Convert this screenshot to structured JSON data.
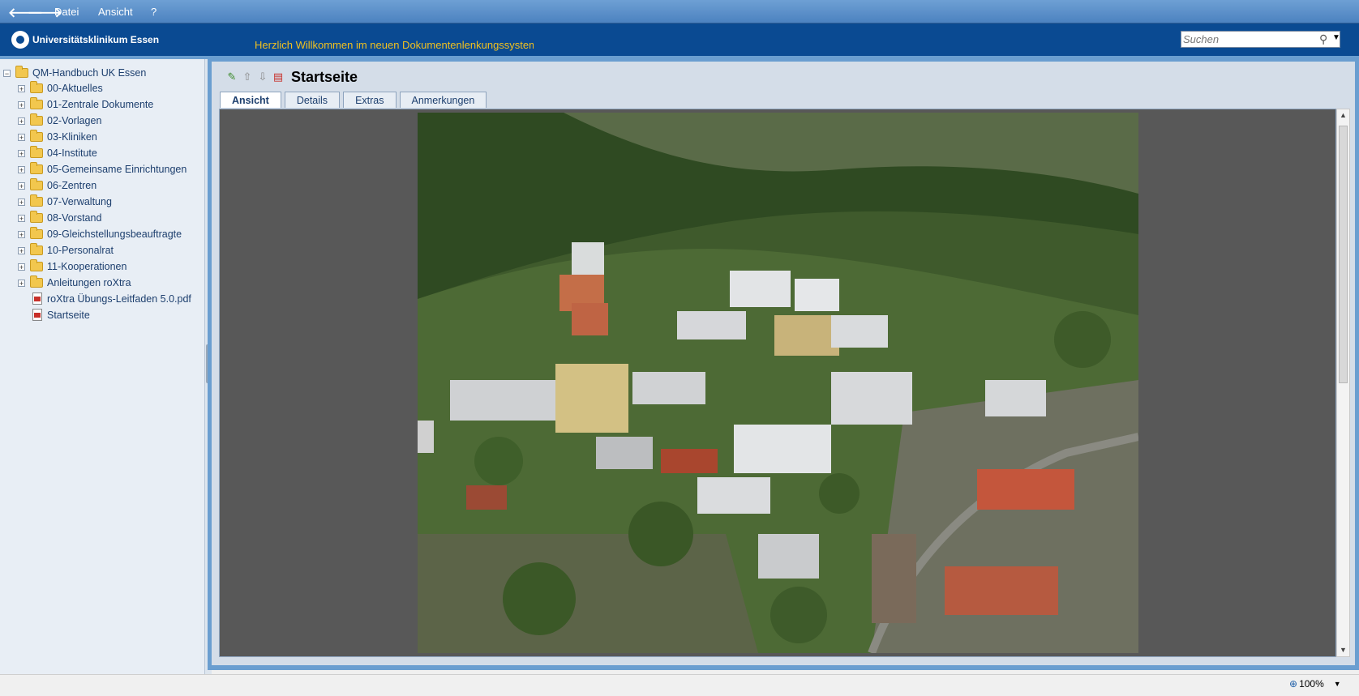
{
  "menubar": {
    "back": "🡐",
    "forward": "🡒",
    "items": [
      "Datei",
      "Ansicht",
      "?"
    ]
  },
  "header": {
    "logo_text": "Universitätsklinikum Essen",
    "welcome": "Herzlich Willkommen im neuen Dokumentenlenkungssystem",
    "search_placeholder": "Suchen",
    "search_icon": "search-icon"
  },
  "tree": {
    "root": "QM-Handbuch UK Essen",
    "folders": [
      "00-Aktuelles",
      "01-Zentrale Dokumente",
      "02-Vorlagen",
      "03-Kliniken",
      "04-Institute",
      "05-Gemeinsame Einrichtungen",
      "06-Zentren",
      "07-Verwaltung",
      "08-Vorstand",
      "09-Gleichstellungsbeauftragte",
      "10-Personalrat",
      "11-Kooperationen",
      "Anleitungen roXtra"
    ],
    "files": [
      "roXtra Übungs-Leitfaden 5.0.pdf",
      "Startseite"
    ]
  },
  "document": {
    "title": "Startseite",
    "tabs": [
      "Ansicht",
      "Details",
      "Extras",
      "Anmerkungen"
    ],
    "active_tab": "Ansicht"
  },
  "status": {
    "zoom": "100%"
  },
  "colors": {
    "header_bg": "#0a4a92",
    "welcome_text": "#f0c020",
    "frame": "#6a9ed0"
  }
}
